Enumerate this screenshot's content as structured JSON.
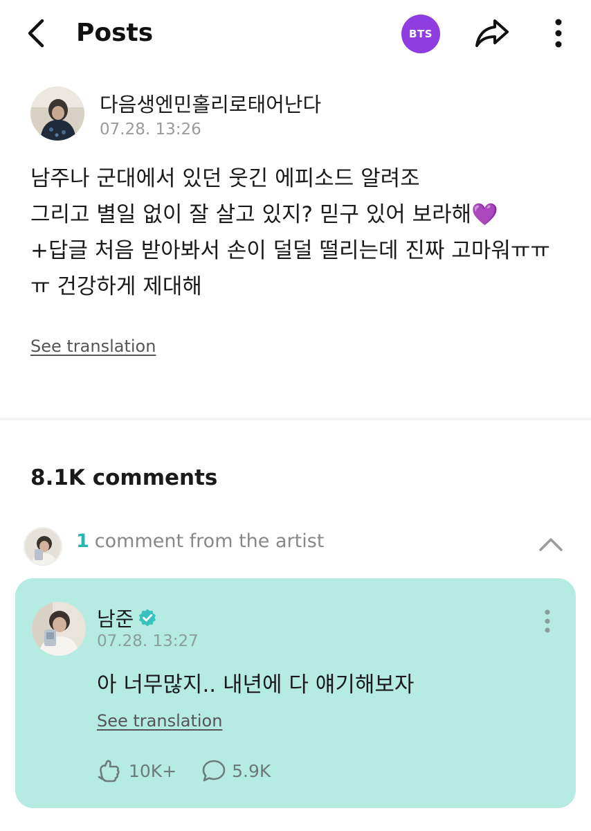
{
  "header": {
    "title": "Posts",
    "community_badge": "BTS",
    "badge_color": "#8f3ce0"
  },
  "post": {
    "author": "다음생엔민홀리로태어난다",
    "timestamp": "07.28. 13:26",
    "body_lines": [
      "남주나 군대에서 있던 웃긴 에피소드 알려조",
      "그리고 별일 없이 잘 살고 있지? 믿구 있어 보라해",
      "+답글 처음 받아봐서 손이 덜덜 떨리는데 진짜 고마워ㅠㅠ",
      "ㅠ 건강하게 제대해"
    ],
    "heart_emoji": "💜",
    "translate_label": "See translation"
  },
  "comments": {
    "title": "8.1K comments",
    "artist_count": "1",
    "artist_label": "comment from the artist",
    "accent_color": "#27b6b1"
  },
  "artist_comment": {
    "author": "남준",
    "timestamp": "07.28. 13:27",
    "text": "아 너무많지.. 내년에 다 얘기해보자",
    "translate_label": "See translation",
    "likes": "10K+",
    "replies": "5.9K",
    "card_color": "#b5ebe1"
  }
}
